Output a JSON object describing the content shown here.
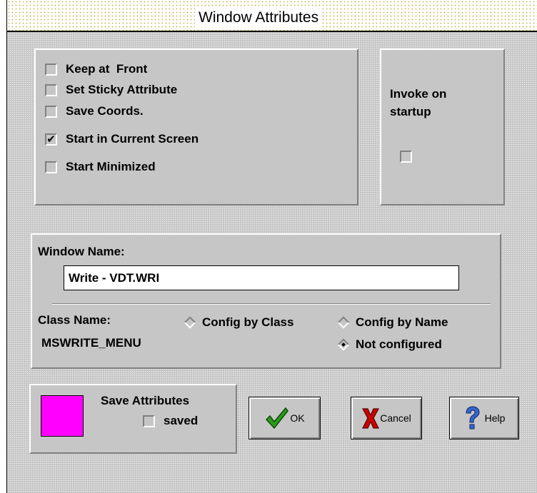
{
  "title": "Window Attributes",
  "options": {
    "keep_front": {
      "label": "Keep at  Front",
      "checked": false
    },
    "sticky": {
      "label": "Set Sticky Attribute",
      "checked": false
    },
    "save_coords": {
      "label": "Save Coords.",
      "checked": false
    },
    "current_screen": {
      "label": "Start in Current Screen",
      "checked": true
    },
    "minimized": {
      "label": "Start Minimized",
      "checked": false
    }
  },
  "invoke": {
    "label_line1": "Invoke on",
    "label_line2": "startup",
    "checked": false
  },
  "window_name": {
    "label": "Window Name:",
    "value": "Write - VDT.WRI"
  },
  "class_name": {
    "label": "Class Name:",
    "value": "MSWRITE_MENU"
  },
  "config": {
    "by_class": "Config by Class",
    "by_name": "Config by Name",
    "not_configured": "Not configured",
    "selected": "not_configured"
  },
  "save_attrs": {
    "label": "Save Attributes",
    "saved_label": "saved",
    "saved_checked": false,
    "color": "#ff00ff"
  },
  "buttons": {
    "ok": "OK",
    "cancel": "Cancel",
    "help": "Help"
  },
  "icons": {
    "ok": "checkmark-icon",
    "cancel": "x-icon",
    "help": "question-mark-icon"
  },
  "colors": {
    "face": "#c6c6c6",
    "swatch": "#ff00ff",
    "ok_icon": "#2a9a1a",
    "cancel_icon": "#cc0000",
    "help_icon": "#3366cc"
  }
}
